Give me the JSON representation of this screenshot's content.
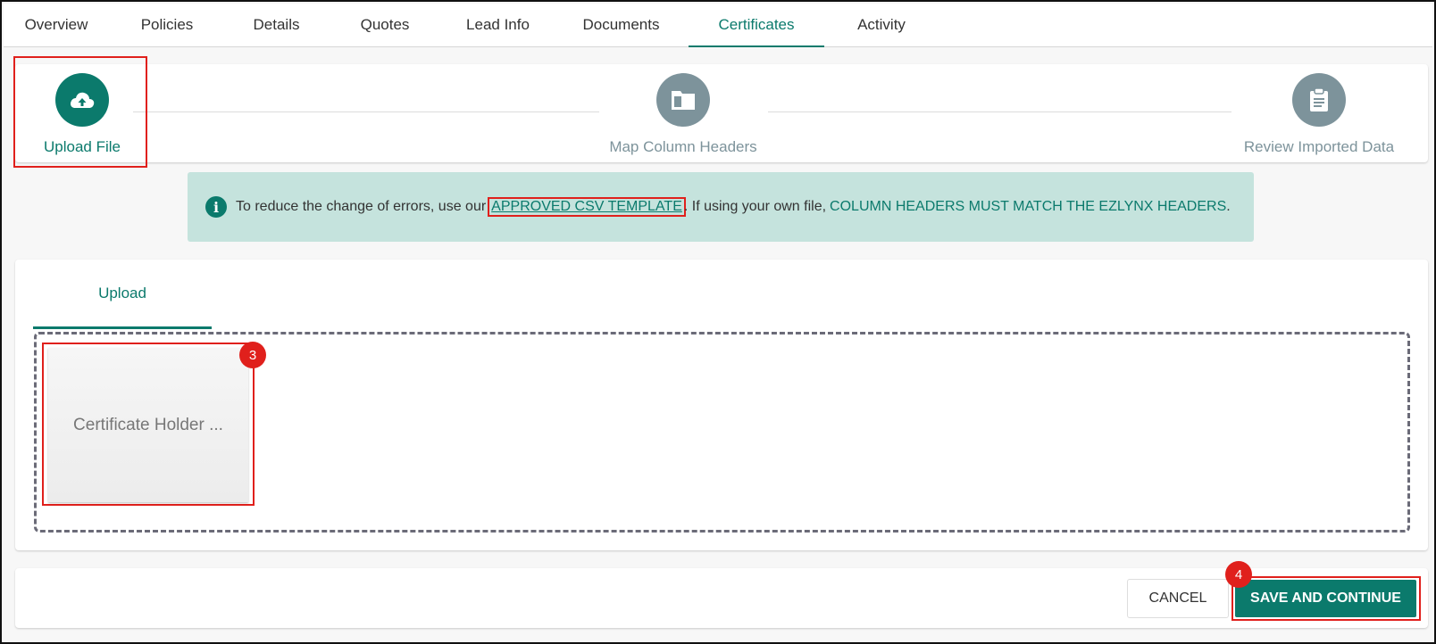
{
  "tabs": [
    {
      "label": "Overview",
      "active": false
    },
    {
      "label": "Policies",
      "active": false
    },
    {
      "label": "Details",
      "active": false
    },
    {
      "label": "Quotes",
      "active": false
    },
    {
      "label": "Lead Info",
      "active": false
    },
    {
      "label": "Documents",
      "active": false
    },
    {
      "label": "Certificates",
      "active": true
    },
    {
      "label": "Activity",
      "active": false
    }
  ],
  "stepper": {
    "steps": [
      {
        "label": "Upload File",
        "icon": "cloud-upload-icon",
        "active": true
      },
      {
        "label": "Map Column Headers",
        "icon": "folder-icon",
        "active": false
      },
      {
        "label": "Review Imported Data",
        "icon": "clipboard-icon",
        "active": false
      }
    ]
  },
  "info": {
    "icon": "info-icon",
    "text_before": "To reduce the change of errors, use our",
    "link": "APPROVED CSV TEMPLATE",
    "text_middle": ". If using your own file,",
    "emphasis": "COLUMN HEADERS MUST MATCH THE EZLYNX HEADERS",
    "text_after": "."
  },
  "upload": {
    "tab_label": "Upload",
    "file_tile_label": "Certificate Holder ...",
    "badge": "3"
  },
  "footer": {
    "cancel_label": "CANCEL",
    "save_label": "SAVE AND CONTINUE",
    "badge": "4"
  },
  "colors": {
    "accent": "#0b7a6c",
    "step_inactive": "#7d939b",
    "info_bg": "#c5e3dd",
    "annotation_red": "#e0201c"
  }
}
